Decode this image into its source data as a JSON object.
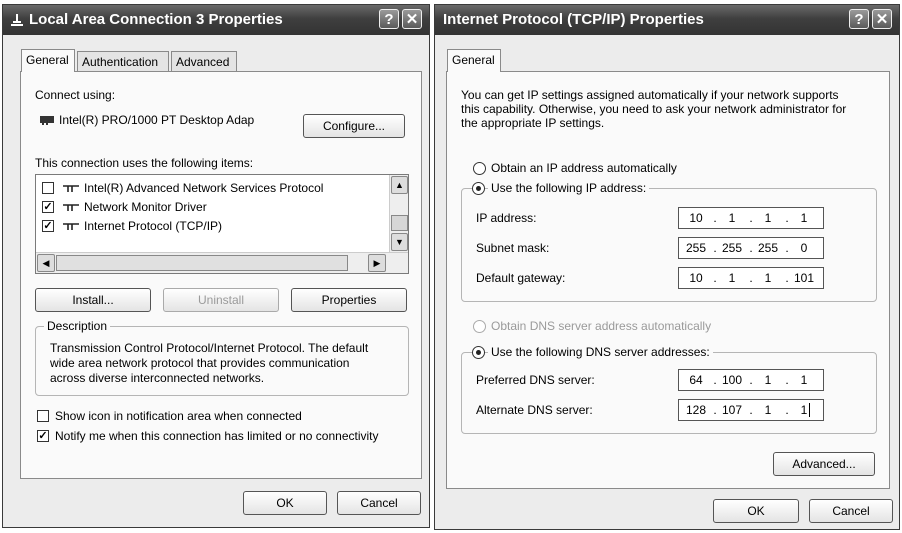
{
  "left_window": {
    "title": "Local Area Connection 3 Properties",
    "tabs": [
      "General",
      "Authentication",
      "Advanced"
    ],
    "connect_using_label": "Connect using:",
    "adapter_name": "Intel(R) PRO/1000 PT Desktop Adap",
    "configure_button": "Configure...",
    "items_label": "This connection uses the following items:",
    "items": [
      {
        "label": "Intel(R) Advanced Network Services Protocol",
        "checked": false
      },
      {
        "label": "Network Monitor Driver",
        "checked": true
      },
      {
        "label": "Internet Protocol (TCP/IP)",
        "checked": true
      }
    ],
    "install_button": "Install...",
    "uninstall_button": "Uninstall",
    "properties_button": "Properties",
    "description_legend": "Description",
    "description_text": [
      "Transmission Control Protocol/Internet Protocol. The default",
      "wide area network protocol that provides communication",
      "across diverse interconnected networks."
    ],
    "show_icon_label": "Show icon in notification area when connected",
    "show_icon_checked": false,
    "notify_label": "Notify me when this connection has limited or no connectivity",
    "notify_checked": true,
    "ok_button": "OK",
    "cancel_button": "Cancel"
  },
  "right_window": {
    "title": "Internet Protocol (TCP/IP) Properties",
    "tabs": [
      "General"
    ],
    "intro_text": [
      "You can get IP settings assigned automatically if your network supports",
      "this capability. Otherwise, you need to ask your network administrator for",
      "the appropriate IP settings."
    ],
    "obtain_ip_auto": "Obtain an IP address automatically",
    "use_following_ip": "Use the following IP address:",
    "ip_label": "IP address:",
    "ip_value": [
      "10",
      "1",
      "1",
      "1"
    ],
    "subnet_label": "Subnet mask:",
    "subnet_value": [
      "255",
      "255",
      "255",
      "0"
    ],
    "gateway_label": "Default gateway:",
    "gateway_value": [
      "10",
      "1",
      "1",
      "101"
    ],
    "obtain_dns_auto": "Obtain DNS server address automatically",
    "use_following_dns": "Use the following DNS server addresses:",
    "preferred_dns_label": "Preferred DNS server:",
    "preferred_dns_value": [
      "64",
      "100",
      "1",
      "1"
    ],
    "alternate_dns_label": "Alternate DNS server:",
    "alternate_dns_value": [
      "128",
      "107",
      "1",
      "1"
    ],
    "advanced_button": "Advanced...",
    "ok_button": "OK",
    "cancel_button": "Cancel"
  },
  "icons": [
    "network-connection-icon",
    "help-icon",
    "close-icon",
    "network-adapter-icon",
    "protocol-icon",
    "scroll-up-icon",
    "scroll-down-icon",
    "scroll-left-icon",
    "scroll-right-icon"
  ]
}
